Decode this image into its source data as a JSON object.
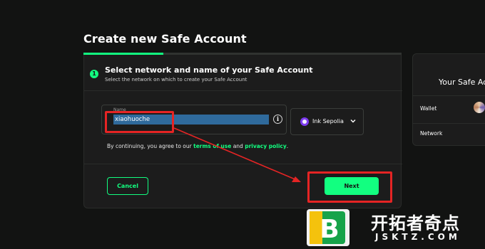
{
  "page": {
    "title": "Create new Safe Account",
    "progress_fraction": 0.25
  },
  "step": {
    "number": "1",
    "title": "Select network and name of your Safe Account",
    "subtitle": "Select the network on which to create your Safe Account"
  },
  "name_field": {
    "label": "Name",
    "value": "xiaohuoche",
    "info_icon": "info-icon"
  },
  "network_select": {
    "selected": "Ink Sepolia",
    "icon": "ink-network-icon"
  },
  "terms": {
    "prefix": "By continuing, you agree to our",
    "terms_link": "terms of use",
    "and": "and",
    "privacy_link": "privacy policy",
    "suffix": "."
  },
  "buttons": {
    "cancel": "Cancel",
    "next": "Next"
  },
  "sidebar": {
    "title": "Your Safe Account",
    "wallet_label": "Wallet",
    "network_label": "Network"
  },
  "watermark": {
    "logo_letter": "B",
    "text": "开拓者奇点",
    "subtext": "JSKTZ.COM"
  },
  "colors": {
    "background": "#121312",
    "card": "#1c1c1c",
    "accent": "#12ff80",
    "annotation": "#e52424",
    "selection": "#2f6a9c"
  }
}
